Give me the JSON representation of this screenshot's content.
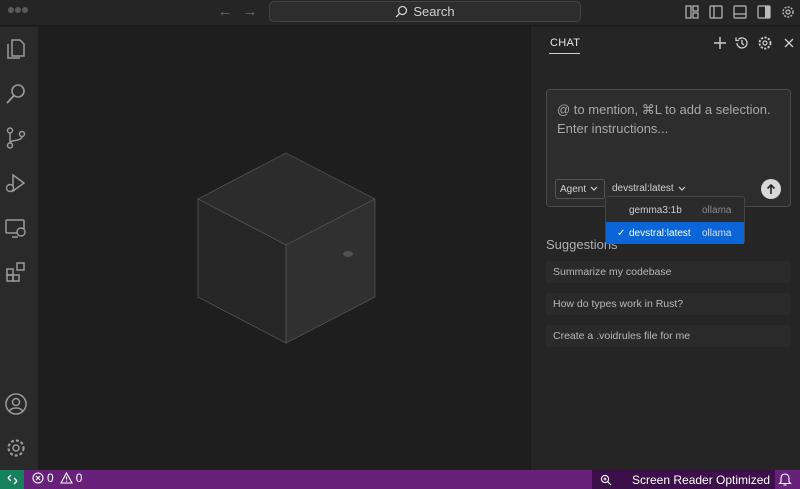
{
  "titlebar": {
    "search_label": "Search"
  },
  "chat": {
    "tab_label": "CHAT",
    "input_placeholder": "@ to mention, ⌘L to add a selection. Enter instructions...",
    "mode_label": "Agent",
    "model_label": "devstral:latest",
    "dropdown": [
      {
        "name": "gemma3:1b",
        "provider": "ollama",
        "selected": false
      },
      {
        "name": "devstral:latest",
        "provider": "ollama",
        "selected": true
      }
    ],
    "suggestions_title": "Suggestions",
    "suggestions": [
      "Summarize my codebase",
      "How do types work in Rust?",
      "Create a .voidrules file for me"
    ]
  },
  "statusbar": {
    "errors": "0",
    "warnings": "0",
    "screen_reader": "Screen Reader Optimized"
  },
  "colors": {
    "accent": "#0a66d8",
    "status": "#68217a",
    "remote": "#16825d"
  }
}
